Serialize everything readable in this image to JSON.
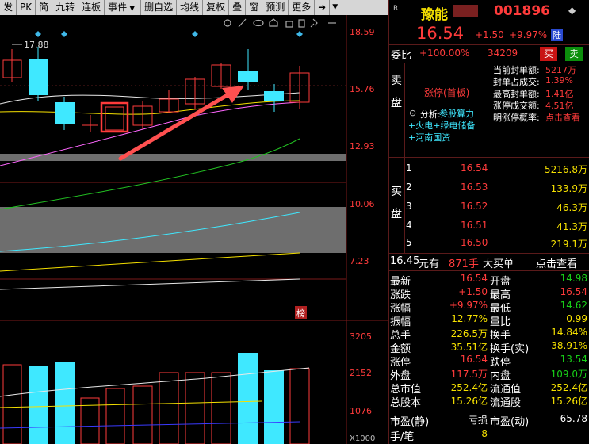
{
  "toolbar": {
    "items": [
      "发",
      "PK",
      "简",
      "九转",
      "连板",
      "事件",
      "",
      "删自选",
      "均线",
      "复权",
      "叠",
      "窗",
      "预测",
      "更多"
    ],
    "event_dropdown_icon": "triangle-down-icon",
    "more_arrow_icon": "arrow-right-icon",
    "end_dropdown_icon": "triangle-down-icon"
  },
  "chart": {
    "price_axis": [
      "18.59",
      "15.76",
      "12.93",
      "10.06",
      "7.23"
    ],
    "volume_axis": [
      "3205",
      "2152",
      "1076"
    ],
    "volume_unit": "X1000",
    "high_marker": "17.88",
    "rank_badge": "榜",
    "toolbar_icons": [
      "settings-icon",
      "pen-icon",
      "eye-icon",
      "house-icon",
      "lock-icon",
      "trash-icon",
      "pin-icon",
      "minus-icon"
    ],
    "colors": {
      "up": "#ff3b3b",
      "down": "#3fe8ff",
      "ma_white": "#e8e8e8",
      "ma_yellow": "#f5e000",
      "ma_magenta": "#ff66ff",
      "ma_green": "#22c022",
      "ma_cyan": "#3fe8ff",
      "gap_band": "#6e6e6e",
      "arrow": "#ff5050"
    }
  },
  "header": {
    "badge": "R",
    "stock_name": "豫能",
    "stock_code": "001896",
    "price": "16.54",
    "change": "+1.50",
    "change_pct": "+9.97%",
    "market_tag": "陆"
  },
  "order": {
    "wei_bi_label": "委比",
    "wei_bi_value": "+100.00%",
    "wei_cha_value": "34209",
    "buy_button": "买",
    "sell_button": "卖"
  },
  "sell_panel": {
    "side_label": "卖盘",
    "status_title": "涨停(首板)",
    "analysis_prefix": "分析:",
    "analysis_text": "参股算力+火电+绿电储备+河南国资",
    "stats": [
      {
        "label": "当前封单额:",
        "value": "5217万"
      },
      {
        "label": "封单占成交:",
        "value": "1.39%"
      },
      {
        "label": "最高封单额:",
        "value": "1.41亿"
      },
      {
        "label": "涨停成交额:",
        "value": "4.51亿"
      },
      {
        "label": "明涨停概率:",
        "value": "点击查看"
      }
    ]
  },
  "buy_panel": {
    "side_label": "买盘",
    "levels": [
      {
        "index": "1",
        "price": "16.54",
        "volume": "5216.8万"
      },
      {
        "index": "2",
        "price": "16.53",
        "volume": "133.9万"
      },
      {
        "index": "3",
        "price": "16.52",
        "volume": "46.3万"
      },
      {
        "index": "4",
        "price": "16.51",
        "volume": "41.3万"
      },
      {
        "index": "5",
        "price": "16.50",
        "volume": "219.1万"
      }
    ]
  },
  "big_order": {
    "price": "16.45",
    "unit_text": "元有",
    "volume": "871手",
    "label": "大买单",
    "action": "点击查看"
  },
  "quote": {
    "rows": [
      {
        "l_label": "最新",
        "l_value": "16.54",
        "r_label": "开盘",
        "r_value": "14.98"
      },
      {
        "l_label": "涨跌",
        "l_value": "+1.50",
        "r_label": "最高",
        "r_value": "16.54"
      },
      {
        "l_label": "涨幅",
        "l_value": "+9.97%",
        "r_label": "最低",
        "r_value": "14.62"
      },
      {
        "l_label": "振幅",
        "l_value": "12.77%",
        "r_label": "量比",
        "r_value": "0.99"
      },
      {
        "l_label": "总手",
        "l_value": "226.5万",
        "r_label": "换手",
        "r_value": "14.84%"
      },
      {
        "l_label": "金额",
        "l_value": "35.51亿",
        "r_label": "换手(实)",
        "r_value": "38.91%"
      },
      {
        "l_label": "涨停",
        "l_value": "16.54",
        "r_label": "跌停",
        "r_value": "13.54"
      },
      {
        "l_label": "外盘",
        "l_value": "117.5万",
        "r_label": "内盘",
        "r_value": "109.0万"
      },
      {
        "l_label": "总市值",
        "l_value": "252.4亿",
        "r_label": "流通值",
        "r_value": "252.4亿"
      },
      {
        "l_label": "总股本",
        "l_value": "15.26亿",
        "r_label": "流通股",
        "r_value": "15.26亿"
      },
      {
        "l_label": "市盈(静)",
        "l_value": "亏损",
        "r_label": "市盈(动)",
        "r_value": "65.78"
      },
      {
        "l_label": "手/笔",
        "l_value": "8",
        "r_label": "",
        "r_value": ""
      }
    ]
  }
}
